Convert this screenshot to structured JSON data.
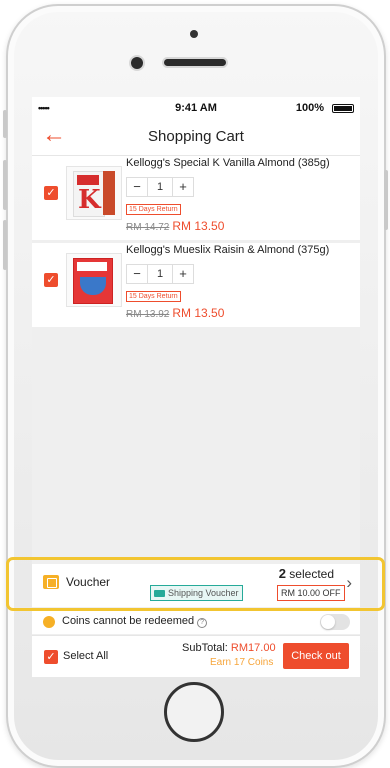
{
  "status_bar": {
    "signal": "•••••",
    "time": "9:41 AM",
    "battery": "100%"
  },
  "nav": {
    "back_icon": "←",
    "title": "Shopping Cart"
  },
  "cart_items": [
    {
      "name": "Kellogg's Special K Vanilla Almond (385g)",
      "qty": "1",
      "tag": "15 Days Return",
      "old_price": "RM 14.72",
      "price": "RM 13.50",
      "checked": "✓"
    },
    {
      "name": "Kellogg's Mueslix Raisin & Almond (375g)",
      "qty": "1",
      "tag": "15 Days Return",
      "old_price": "RM 13.92",
      "price": "RM 13.50",
      "checked": "✓"
    }
  ],
  "stepper": {
    "minus": "−",
    "plus": "+"
  },
  "voucher": {
    "label": "Voucher",
    "count": "2",
    "selected_suffix": " selected",
    "chevron": "›",
    "shipping_voucher": "Shipping Voucher",
    "discount": "RM 10.00 OFF"
  },
  "coins": {
    "text": "Coins cannot be redeemed",
    "info": "?"
  },
  "bottom": {
    "select_all": "Select All",
    "checked": "✓",
    "subtotal_label": "SubTotal: ",
    "subtotal_amount": "RM17.00",
    "earn": "Earn 17 Coins",
    "checkout": "Check out"
  },
  "colors": {
    "accent": "#ee4d2d",
    "highlight": "#f2c531",
    "coin": "#f6b026",
    "teal": "#26aa99"
  }
}
